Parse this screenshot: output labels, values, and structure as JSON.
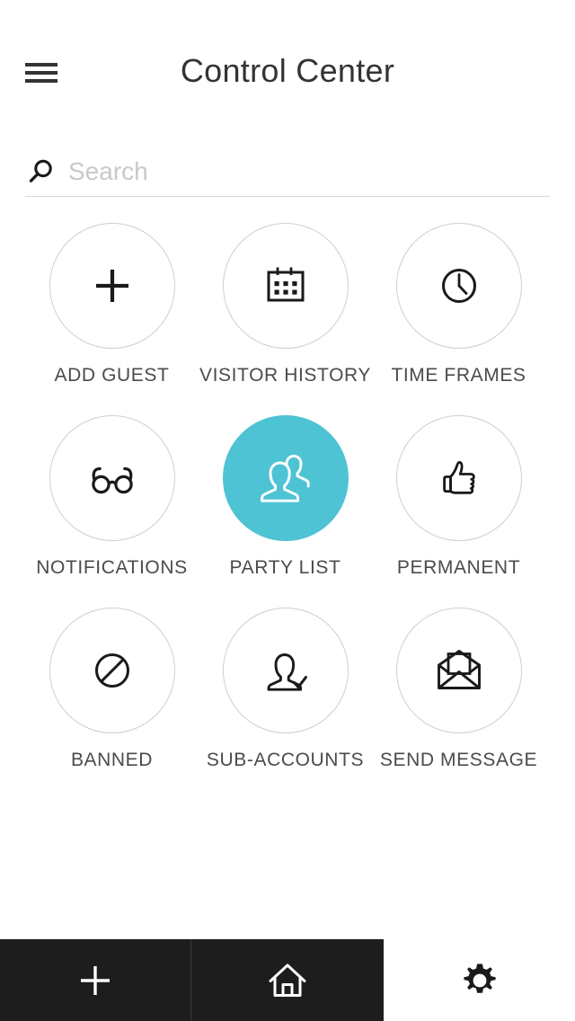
{
  "header": {
    "title": "Control Center",
    "menu_icon": "hamburger-menu-icon"
  },
  "search": {
    "placeholder": "Search",
    "value": "",
    "icon": "search-icon"
  },
  "grid": {
    "items": [
      {
        "label": "ADD GUEST",
        "icon": "plus-icon",
        "active": false
      },
      {
        "label": "VISITOR HISTORY",
        "icon": "calendar-icon",
        "active": false
      },
      {
        "label": "TIME FRAMES",
        "icon": "clock-icon",
        "active": false
      },
      {
        "label": "NOTIFICATIONS",
        "icon": "glasses-icon",
        "active": false
      },
      {
        "label": "PARTY LIST",
        "icon": "group-users-icon",
        "active": true
      },
      {
        "label": "PERMANENT",
        "icon": "thumbs-up-icon",
        "active": false
      },
      {
        "label": "BANNED",
        "icon": "ban-icon",
        "active": false
      },
      {
        "label": "SUB-ACCOUNTS",
        "icon": "user-check-icon",
        "active": false
      },
      {
        "label": "SEND MESSAGE",
        "icon": "open-envelope-icon",
        "active": false
      }
    ]
  },
  "bottom_nav": {
    "items": [
      {
        "name": "add",
        "icon": "plus-icon"
      },
      {
        "name": "home",
        "icon": "home-icon"
      },
      {
        "name": "settings",
        "icon": "gear-icon"
      }
    ]
  },
  "colors": {
    "accent": "#4ec3d4",
    "bottom_bar": "#1d1d1d",
    "icon_stroke": "#1a1a1a",
    "circle_border": "#cfcfcf",
    "label_text": "#4b4b4b",
    "placeholder": "#c9c9c9"
  }
}
